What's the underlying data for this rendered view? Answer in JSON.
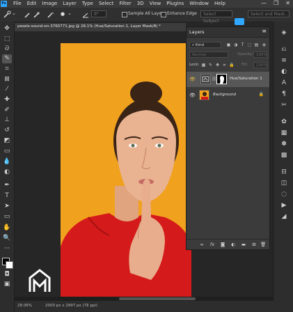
{
  "app": {
    "logo": "Ps"
  },
  "menu": [
    "File",
    "Edit",
    "Image",
    "Layer",
    "Type",
    "Select",
    "Filter",
    "3D",
    "View",
    "Plugins",
    "Window",
    "Help"
  ],
  "window_controls": [
    "—",
    "❐",
    "✕"
  ],
  "options": {
    "angle": "0°",
    "sample_all_layers": "Sample All Layers",
    "enhance_edge": "Enhance Edge",
    "select_subject": "Select Subject",
    "select_and_mask": "Select and Mask..."
  },
  "document": {
    "tab_title": "pexels-sound-on-3760771.jpg @ 28.1% (Hue/Saturation 1, Layer Mask/8) *"
  },
  "layers_panel": {
    "title": "Layers",
    "menu_icon": "≡",
    "kind_label": "Kind",
    "blend_mode": "Normal",
    "opacity_label": "Opacity:",
    "opacity_value": "100%",
    "lock_label": "Lock:",
    "fill_label": "Fill:",
    "fill_value": "100%",
    "layers": [
      {
        "name": "Hue/Saturation 1",
        "selected": true
      },
      {
        "name": "Background",
        "selected": false
      }
    ],
    "footer_icons": [
      "link-icon",
      "fx-icon",
      "mask-icon",
      "adjustment-icon",
      "folder-icon",
      "new-layer-icon",
      "trash-icon"
    ]
  },
  "status": {
    "zoom": "28.06%",
    "doc_size": "2000 px x 2997 px (72 ppi)"
  },
  "colors": {
    "photo_bg": "#f0a11d",
    "shirt": "#d41a1a",
    "accent": "#31a8ff"
  }
}
